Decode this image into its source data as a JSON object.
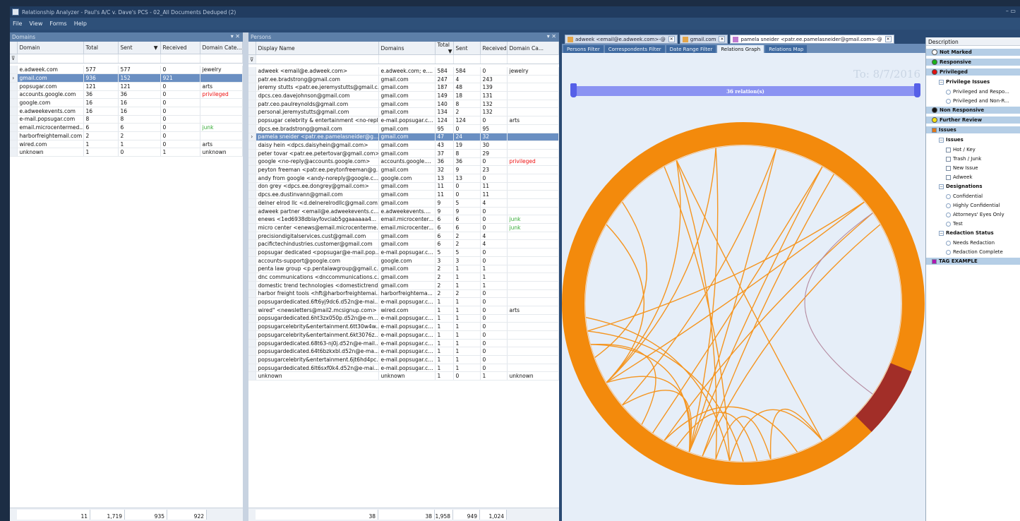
{
  "window": {
    "title": "Relationship Analyzer - Paul's A/C v. Dave's PCS - 02_All Documents Deduped (2)",
    "controls": "– ▭"
  },
  "menu": [
    "File",
    "View",
    "Forms",
    "Help"
  ],
  "domains": {
    "panel_title": "Domains",
    "columns": [
      "Domain",
      "Total",
      "Sent",
      "Received",
      "Domain Cate..."
    ],
    "rows": [
      {
        "domain": "e.adweek.com",
        "total": "577",
        "sent": "577",
        "received": "0",
        "cat": "jewelry"
      },
      {
        "domain": "gmail.com",
        "total": "936",
        "sent": "152",
        "received": "921",
        "cat": "",
        "selected": true
      },
      {
        "domain": "popsugar.com",
        "total": "121",
        "sent": "121",
        "received": "0",
        "cat": "arts"
      },
      {
        "domain": "accounts.google.com",
        "total": "36",
        "sent": "36",
        "received": "0",
        "cat": "privileged"
      },
      {
        "domain": "google.com",
        "total": "16",
        "sent": "16",
        "received": "0",
        "cat": ""
      },
      {
        "domain": "e.adweekevents.com",
        "total": "16",
        "sent": "16",
        "received": "0",
        "cat": ""
      },
      {
        "domain": "e-mail.popsugar.com",
        "total": "8",
        "sent": "8",
        "received": "0",
        "cat": ""
      },
      {
        "domain": "email.microcentermed...",
        "total": "6",
        "sent": "6",
        "received": "0",
        "cat": "junk"
      },
      {
        "domain": "harborfreightemail.com",
        "total": "2",
        "sent": "2",
        "received": "0",
        "cat": ""
      },
      {
        "domain": "wired.com",
        "total": "1",
        "sent": "1",
        "received": "0",
        "cat": "arts"
      },
      {
        "domain": "unknown",
        "total": "1",
        "sent": "0",
        "received": "1",
        "cat": "unknown"
      }
    ],
    "footer": [
      "11",
      "1,719",
      "935",
      "922"
    ]
  },
  "persons": {
    "panel_title": "Persons",
    "columns": [
      "Display Name",
      "Domains",
      "Total",
      "Sent",
      "Received",
      "Domain Ca..."
    ],
    "rows": [
      {
        "name": "adweek <email@e.adweek.com>",
        "domains": "e.adweek.com; e....",
        "total": "584",
        "sent": "584",
        "received": "0",
        "cat": "jewelry"
      },
      {
        "name": "patr.ee.bradstrong@gmail.com",
        "domains": "gmail.com",
        "total": "247",
        "sent": "4",
        "received": "243",
        "cat": ""
      },
      {
        "name": "jeremy stutts <patr.ee.jeremystutts@gmail.c...",
        "domains": "gmail.com",
        "total": "187",
        "sent": "48",
        "received": "139",
        "cat": ""
      },
      {
        "name": "dpcs.ceo.davejohnson@gmail.com",
        "domains": "gmail.com",
        "total": "149",
        "sent": "18",
        "received": "131",
        "cat": ""
      },
      {
        "name": "patr.ceo.paulreynolds@gmail.com",
        "domains": "gmail.com",
        "total": "140",
        "sent": "8",
        "received": "132",
        "cat": ""
      },
      {
        "name": "personal.jeremystutts@gmail.com",
        "domains": "gmail.com",
        "total": "134",
        "sent": "2",
        "received": "132",
        "cat": ""
      },
      {
        "name": "popsugar celebrity & entertainment <no-repl...",
        "domains": "e-mail.popsugar.c...",
        "total": "124",
        "sent": "124",
        "received": "0",
        "cat": "arts"
      },
      {
        "name": "dpcs.ee.bradstrong@gmail.com",
        "domains": "gmail.com",
        "total": "95",
        "sent": "0",
        "received": "95",
        "cat": ""
      },
      {
        "name": "pamela sneider <patr.ee.pamelasneider@g...",
        "domains": "gmail.com",
        "total": "47",
        "sent": "24",
        "received": "32",
        "cat": "",
        "selected": true
      },
      {
        "name": "daisy hein <dpcs.daisyhein@gmail.com>",
        "domains": "gmail.com",
        "total": "43",
        "sent": "19",
        "received": "30",
        "cat": ""
      },
      {
        "name": "peter tovar <patr.ee.petertovar@gmail.com>",
        "domains": "gmail.com",
        "total": "37",
        "sent": "8",
        "received": "29",
        "cat": ""
      },
      {
        "name": "google <no-reply@accounts.google.com>",
        "domains": "accounts.google....",
        "total": "36",
        "sent": "36",
        "received": "0",
        "cat": "privileged"
      },
      {
        "name": "peyton freeman <patr.ee.peytonfreeman@g...",
        "domains": "gmail.com",
        "total": "32",
        "sent": "9",
        "received": "23",
        "cat": ""
      },
      {
        "name": "andy from google <andy-noreply@google.c...",
        "domains": "google.com",
        "total": "13",
        "sent": "13",
        "received": "0",
        "cat": ""
      },
      {
        "name": "don grey <dpcs.ee.dongrey@gmail.com>",
        "domains": "gmail.com",
        "total": "11",
        "sent": "0",
        "received": "11",
        "cat": ""
      },
      {
        "name": "dpcs.ee.dustinvann@gmail.com",
        "domains": "gmail.com",
        "total": "11",
        "sent": "0",
        "received": "11",
        "cat": ""
      },
      {
        "name": "delner elrod llc <d.delnerelrodllc@gmail.com>",
        "domains": "gmail.com",
        "total": "9",
        "sent": "5",
        "received": "4",
        "cat": ""
      },
      {
        "name": "adweek partner <email@e.adweekevents.c...",
        "domains": "e.adweekevents....",
        "total": "9",
        "sent": "9",
        "received": "0",
        "cat": ""
      },
      {
        "name": "enews <1ed6938dblayfovciab5ggaaaaaa4...",
        "domains": "email.microcenter...",
        "total": "6",
        "sent": "6",
        "received": "0",
        "cat": "junk"
      },
      {
        "name": "micro center <enews@email.microcenterme...",
        "domains": "email.microcenter...",
        "total": "6",
        "sent": "6",
        "received": "0",
        "cat": "junk"
      },
      {
        "name": "precisiondigitalservices.cust@gmail.com",
        "domains": "gmail.com",
        "total": "6",
        "sent": "2",
        "received": "4",
        "cat": ""
      },
      {
        "name": "pacifictechindustries.customer@gmail.com",
        "domains": "gmail.com",
        "total": "6",
        "sent": "2",
        "received": "4",
        "cat": ""
      },
      {
        "name": "popsugar dedicated <popsugar@e-mail.pop...",
        "domains": "e-mail.popsugar.c...",
        "total": "5",
        "sent": "5",
        "received": "0",
        "cat": ""
      },
      {
        "name": "accounts-support@google.com",
        "domains": "google.com",
        "total": "3",
        "sent": "3",
        "received": "0",
        "cat": ""
      },
      {
        "name": "penta law group <p.pentalawgroup@gmail.c...",
        "domains": "gmail.com",
        "total": "2",
        "sent": "1",
        "received": "1",
        "cat": ""
      },
      {
        "name": "dnc communications <dnccommunications.c...",
        "domains": "gmail.com",
        "total": "2",
        "sent": "1",
        "received": "1",
        "cat": ""
      },
      {
        "name": "domestic trend technologies <domestictrend...",
        "domains": "gmail.com",
        "total": "2",
        "sent": "1",
        "received": "1",
        "cat": ""
      },
      {
        "name": "harbor freight tools <hft@harborfreightemai...",
        "domains": "harborfreightema...",
        "total": "2",
        "sent": "2",
        "received": "0",
        "cat": ""
      },
      {
        "name": "popsugardedicated.6ft6yj9dc6.d52n@e-mai...",
        "domains": "e-mail.popsugar.c...",
        "total": "1",
        "sent": "1",
        "received": "0",
        "cat": ""
      },
      {
        "name": "wired\" <newsletters@mail2.mcsignup.com> ...",
        "domains": "wired.com",
        "total": "1",
        "sent": "1",
        "received": "0",
        "cat": "arts"
      },
      {
        "name": "popsugardedicated.6ht3zx050p.d52n@e-m...",
        "domains": "e-mail.popsugar.c...",
        "total": "1",
        "sent": "1",
        "received": "0",
        "cat": ""
      },
      {
        "name": "popsugarcelebrity&entertainment.6tt30w4w...",
        "domains": "e-mail.popsugar.c...",
        "total": "1",
        "sent": "1",
        "received": "0",
        "cat": ""
      },
      {
        "name": "popsugarcelebrity&entertainment.6kt3076z...",
        "domains": "e-mail.popsugar.c...",
        "total": "1",
        "sent": "1",
        "received": "0",
        "cat": ""
      },
      {
        "name": "popsugardedicated.68t63-nj0j.d52n@e-mail...",
        "domains": "e-mail.popsugar.c...",
        "total": "1",
        "sent": "1",
        "received": "0",
        "cat": ""
      },
      {
        "name": "popsugardedicated.64t6bzkxbl.d52n@e-ma...",
        "domains": "e-mail.popsugar.c...",
        "total": "1",
        "sent": "1",
        "received": "0",
        "cat": ""
      },
      {
        "name": "popsugarcelebrity&entertainment.6jt6hd4pc...",
        "domains": "e-mail.popsugar.c...",
        "total": "1",
        "sent": "1",
        "received": "0",
        "cat": ""
      },
      {
        "name": "popsugardedicated.6lt6sxf0k4.d52n@e-mai...",
        "domains": "e-mail.popsugar.c...",
        "total": "1",
        "sent": "1",
        "received": "0",
        "cat": ""
      },
      {
        "name": "unknown",
        "domains": "unknown",
        "total": "1",
        "sent": "0",
        "received": "1",
        "cat": "unknown"
      }
    ],
    "footer": [
      "38",
      "38",
      "1,958",
      "949",
      "1,024"
    ]
  },
  "graph": {
    "doc_tabs": [
      {
        "label": "adweek <email@e.adweek.com>-@",
        "active": false
      },
      {
        "label": "gmail.com",
        "active": false
      },
      {
        "label": "pamela sneider <patr.ee.pamelasneider@gmail.com>-@",
        "active": true
      }
    ],
    "sub_tabs": [
      {
        "label": "Persons Filter",
        "active": false
      },
      {
        "label": "Correspondents Filter",
        "active": false
      },
      {
        "label": "Date Range Filter",
        "active": false
      },
      {
        "label": "Relations Graph",
        "active": true
      },
      {
        "label": "Relations Map",
        "active": false
      }
    ],
    "to_date": "To: 8/7/2016",
    "relations_label": "36 relation(s)",
    "ring_color": "#f38a0c",
    "highlight_color": "#a22e28",
    "slider_color": "#8b93f2"
  },
  "tags": {
    "header": "Description",
    "nodes": [
      {
        "label": "Not Marked",
        "type": "hdr",
        "mark": "dot",
        "color": "#ffffff",
        "indent": 0
      },
      {
        "label": "Responsive",
        "type": "hdr",
        "mark": "dot",
        "color": "#19b319",
        "indent": 0
      },
      {
        "label": "Privileged",
        "type": "hdr",
        "mark": "dot",
        "color": "#e01010",
        "indent": 0
      },
      {
        "label": "Privilege Issues",
        "type": "group",
        "mark": "exp",
        "indent": 1
      },
      {
        "label": "Privileged and Respo...",
        "type": "leaf",
        "mark": "rc",
        "indent": 2
      },
      {
        "label": "Privileged and Non-R...",
        "type": "leaf",
        "mark": "rc",
        "indent": 2
      },
      {
        "label": "Non Responsive",
        "type": "hdr",
        "mark": "dot",
        "color": "#111111",
        "indent": 0
      },
      {
        "label": "Further Review",
        "type": "hdr",
        "mark": "dot",
        "color": "#f4e012",
        "indent": 0
      },
      {
        "label": "Issues",
        "type": "hdr",
        "mark": "sq",
        "color": "#e07818",
        "indent": 0
      },
      {
        "label": "Issues",
        "type": "group",
        "mark": "exp",
        "indent": 1
      },
      {
        "label": "Hot / Key",
        "type": "leaf",
        "mark": "sq",
        "indent": 2
      },
      {
        "label": "Trash / Junk",
        "type": "leaf",
        "mark": "sq",
        "indent": 2
      },
      {
        "label": "New Issue",
        "type": "leaf",
        "mark": "sq",
        "indent": 2
      },
      {
        "label": "Adweek",
        "type": "leaf",
        "mark": "sq",
        "indent": 2
      },
      {
        "label": "Designations",
        "type": "group",
        "mark": "exp",
        "indent": 1
      },
      {
        "label": "Confidential",
        "type": "leaf",
        "mark": "rc",
        "indent": 2
      },
      {
        "label": "Highly Confidential",
        "type": "leaf",
        "mark": "rc",
        "indent": 2
      },
      {
        "label": "Attorneys' Eyes Only",
        "type": "leaf",
        "mark": "rc",
        "indent": 2
      },
      {
        "label": "Test",
        "type": "leaf",
        "mark": "rc",
        "indent": 2
      },
      {
        "label": "Redaction Status",
        "type": "group",
        "mark": "exp",
        "indent": 1
      },
      {
        "label": "Needs Redaction",
        "type": "leaf",
        "mark": "rc",
        "indent": 2
      },
      {
        "label": "Redaction Complete",
        "type": "leaf",
        "mark": "rc",
        "indent": 2
      },
      {
        "label": "TAG EXAMPLE",
        "type": "hdr",
        "mark": "sq",
        "color": "#b018b0",
        "indent": 0
      }
    ]
  }
}
